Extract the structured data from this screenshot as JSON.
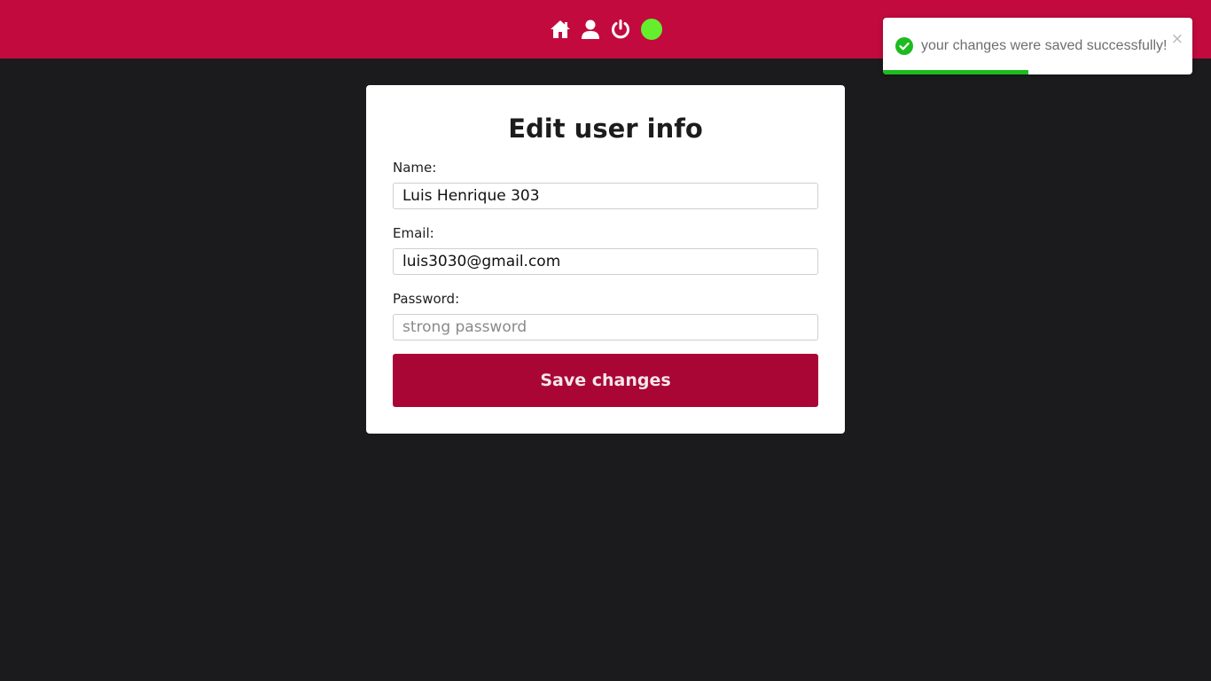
{
  "colors": {
    "navbar": "#c20a3e",
    "page_background": "#1b1b1d",
    "status_dot": "#63ee2e",
    "save_button": "#a90535",
    "toast_success": "#1cbb1f"
  },
  "navbar": {
    "icons": [
      "home-icon",
      "user-icon",
      "power-icon",
      "online-status-dot"
    ]
  },
  "form": {
    "title": "Edit user info",
    "name": {
      "label": "Name:",
      "value": "Luis Henrique 303"
    },
    "email": {
      "label": "Email:",
      "value": "luis3030@gmail.com"
    },
    "password": {
      "label": "Password:",
      "value": "",
      "placeholder": "strong password"
    },
    "save_label": "Save changes"
  },
  "toast": {
    "message": "your changes were saved successfully!",
    "close_label": "×",
    "icon": "check-circle-icon",
    "progress": 0.47
  }
}
